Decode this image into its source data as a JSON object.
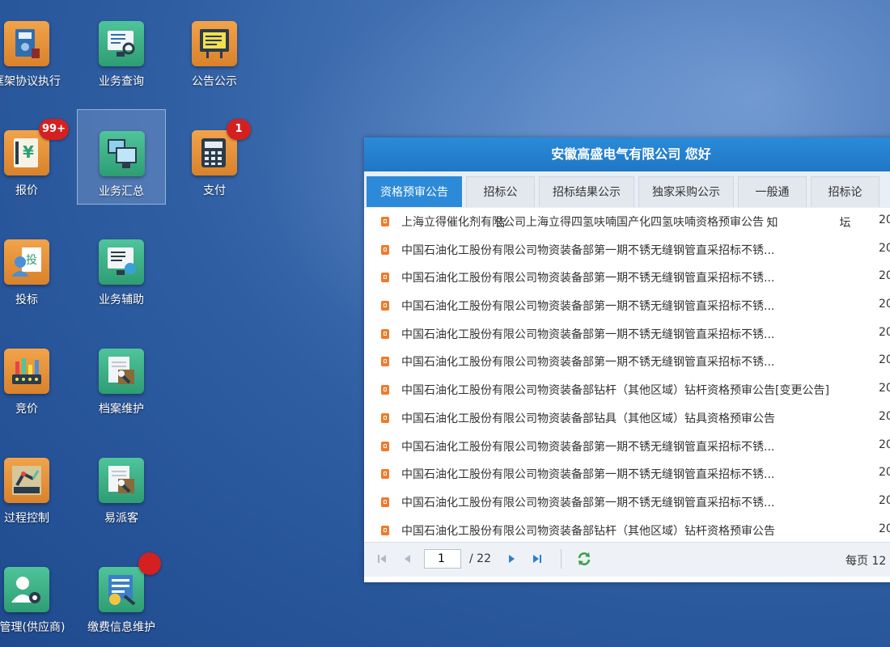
{
  "desktop": {
    "icons": [
      {
        "label": "框架协议执行",
        "badge": ""
      },
      {
        "label": "业务查询",
        "badge": ""
      },
      {
        "label": "公告公示",
        "badge": ""
      },
      {
        "label": "报价",
        "badge": "99+"
      },
      {
        "label": "业务汇总",
        "badge": ""
      },
      {
        "label": "支付",
        "badge": "1"
      },
      {
        "label": "投标",
        "badge": ""
      },
      {
        "label": "业务辅助",
        "badge": ""
      },
      {
        "label": "竞价",
        "badge": ""
      },
      {
        "label": "档案维护",
        "badge": ""
      },
      {
        "label": "过程控制",
        "badge": ""
      },
      {
        "label": "易派客",
        "badge": ""
      },
      {
        "label": "户管理(供应商)",
        "badge": ""
      },
      {
        "label": "缴费信息维护",
        "badge": ""
      }
    ],
    "colors": {
      "orange_tile": "#e8953a",
      "green_tile": "#3fb087",
      "badge": "#d42020"
    }
  },
  "panel": {
    "title": "安徽高盛电气有限公司 您好",
    "tabs": [
      "资格预审公告",
      "招标公告",
      "招标结果公示",
      "独家采购公示",
      "一般通知",
      "招标论坛"
    ],
    "active_tab": "资格预审公告",
    "rows": [
      {
        "title": "上海立得催化剂有限公司上海立得四氢呋喃国产化四氢呋喃资格预审公告",
        "date": "20"
      },
      {
        "title": "中国石油化工股份有限公司物资装备部第一期不锈无缝钢管直采招标不锈...",
        "date": "20"
      },
      {
        "title": "中国石油化工股份有限公司物资装备部第一期不锈无缝钢管直采招标不锈...",
        "date": "20"
      },
      {
        "title": "中国石油化工股份有限公司物资装备部第一期不锈无缝钢管直采招标不锈...",
        "date": "20"
      },
      {
        "title": "中国石油化工股份有限公司物资装备部第一期不锈无缝钢管直采招标不锈...",
        "date": "20"
      },
      {
        "title": "中国石油化工股份有限公司物资装备部第一期不锈无缝钢管直采招标不锈...",
        "date": "20"
      },
      {
        "title": "中国石油化工股份有限公司物资装备部钻杆（其他区域）钻杆资格预审公告[变更公告]",
        "date": "20"
      },
      {
        "title": "中国石油化工股份有限公司物资装备部钻具（其他区域）钻具资格预审公告",
        "date": "20"
      },
      {
        "title": "中国石油化工股份有限公司物资装备部第一期不锈无缝钢管直采招标不锈...",
        "date": "20"
      },
      {
        "title": "中国石油化工股份有限公司物资装备部第一期不锈无缝钢管直采招标不锈...",
        "date": "20"
      },
      {
        "title": "中国石油化工股份有限公司物资装备部第一期不锈无缝钢管直采招标不锈...",
        "date": "20"
      },
      {
        "title": "中国石油化工股份有限公司物资装备部钻杆（其他区域）钻杆资格预审公告",
        "date": "20"
      }
    ],
    "pager": {
      "current_page": "1",
      "total_pages": "/ 22",
      "per_page": "每页 12"
    }
  }
}
